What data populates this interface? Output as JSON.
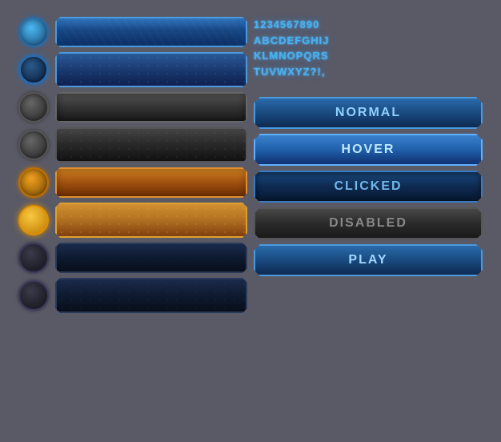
{
  "typography": {
    "numbers": "1234567890",
    "line1": "ABCDEFGHIJ",
    "line2": "KLMNOPQRS",
    "line3": "TUVWXYZ?!,"
  },
  "states": {
    "normal": "NORMAL",
    "hover": "HOVER",
    "clicked": "CLICKED",
    "disabled": "DISABLED",
    "play": "PLAY"
  },
  "buttons": {
    "rows": [
      {
        "circle": "blue",
        "style": "blue"
      },
      {
        "circle": "blue-ring",
        "style": "blue-hex"
      },
      {
        "circle": "gray",
        "style": "gray"
      },
      {
        "circle": "gray",
        "style": "gray-hex"
      },
      {
        "circle": "gold",
        "style": "gold"
      },
      {
        "circle": "gold-bright",
        "style": "gold-hex"
      },
      {
        "circle": "dark",
        "style": "navy"
      },
      {
        "circle": "dark",
        "style": "navy-hex"
      }
    ]
  }
}
